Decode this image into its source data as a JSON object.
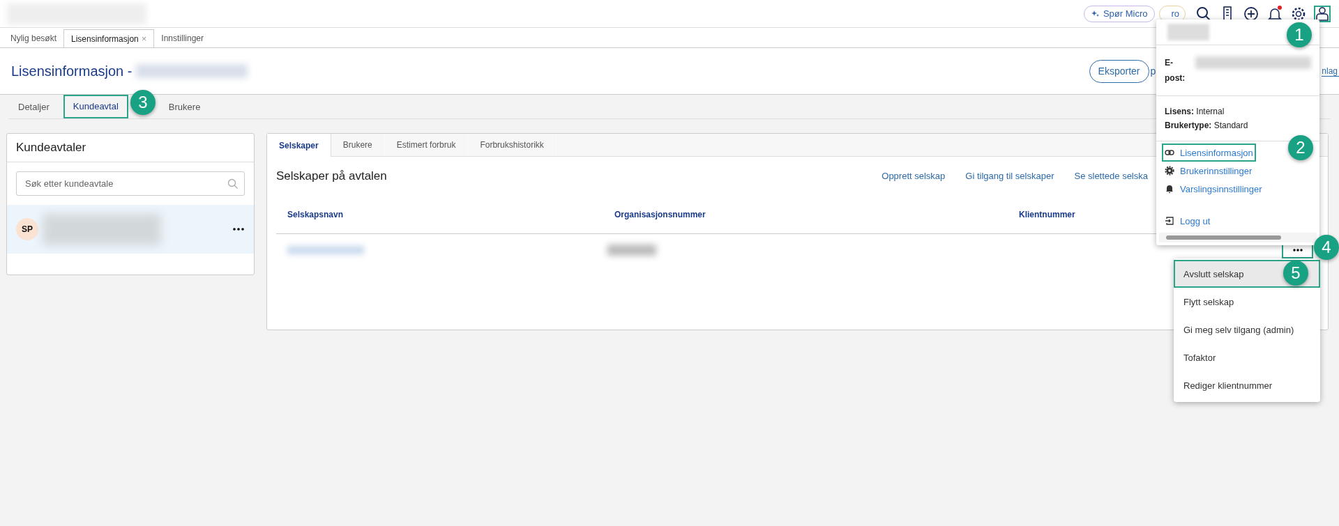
{
  "top_bar": {
    "ask_button": "Spør Micro",
    "partial_button": "ro",
    "notifications_unread": true
  },
  "open_tabs": [
    {
      "label": "Nylig besøkt",
      "selected": false,
      "closable": false
    },
    {
      "label": "Lisensinformasjon",
      "selected": true,
      "closable": true,
      "close_glyph": "×"
    },
    {
      "label": "Innstillinger",
      "selected": false,
      "closable": false
    }
  ],
  "page": {
    "title": "Lisensinformasjon -",
    "export_button": "Eksporter",
    "fragment_left": "p",
    "fragment_right": "nlag"
  },
  "page_tabs": [
    {
      "label": "Detaljer",
      "selected": false
    },
    {
      "label": "Kundeavtal",
      "selected": true
    },
    {
      "label": "Brukere",
      "selected": false
    }
  ],
  "agreements": {
    "title": "Kundeavtaler",
    "search": {
      "placeholder": "Søk etter kundeavtale"
    },
    "items": [
      {
        "initials": "SP",
        "selected": true
      }
    ]
  },
  "companies": {
    "tabs": [
      {
        "label": "Selskaper",
        "selected": true
      },
      {
        "label": "Brukere",
        "selected": false
      },
      {
        "label": "Estimert forbruk",
        "selected": false
      },
      {
        "label": "Forbrukshistorikk",
        "selected": false
      }
    ],
    "heading": "Selskaper på avtalen",
    "actions": [
      "Opprett selskap",
      "Gi tilgang til selskaper",
      "Se slettede selska"
    ],
    "columns": [
      "Selskapsnavn",
      "Organisasjonsnummer",
      "Klientnummer"
    ]
  },
  "profile_menu": {
    "email_label": "E-post:",
    "info": [
      {
        "label": "Lisens:",
        "value": "Internal"
      },
      {
        "label": "Brukertype:",
        "value": "Standard"
      }
    ],
    "items": [
      {
        "label": "Lisensinformasjon",
        "kind": "link"
      },
      {
        "label": "Brukerinnstillinger",
        "kind": "gear"
      },
      {
        "label": "Varslingsinnstillinger",
        "kind": "bell"
      },
      {
        "label": "Logg ut",
        "kind": "logout"
      }
    ]
  },
  "context_menu": [
    {
      "label": "Avslutt selskap",
      "selected": true
    },
    {
      "label": "Flytt selskap",
      "selected": false
    },
    {
      "label": "Gi meg selv tilgang (admin)",
      "selected": false
    },
    {
      "label": "Tofaktor",
      "selected": false
    },
    {
      "label": "Rediger klientnummer",
      "selected": false
    }
  ],
  "callouts": [
    {
      "number": "1"
    },
    {
      "number": "2"
    },
    {
      "number": "3"
    },
    {
      "number": "4"
    },
    {
      "number": "5"
    }
  ]
}
